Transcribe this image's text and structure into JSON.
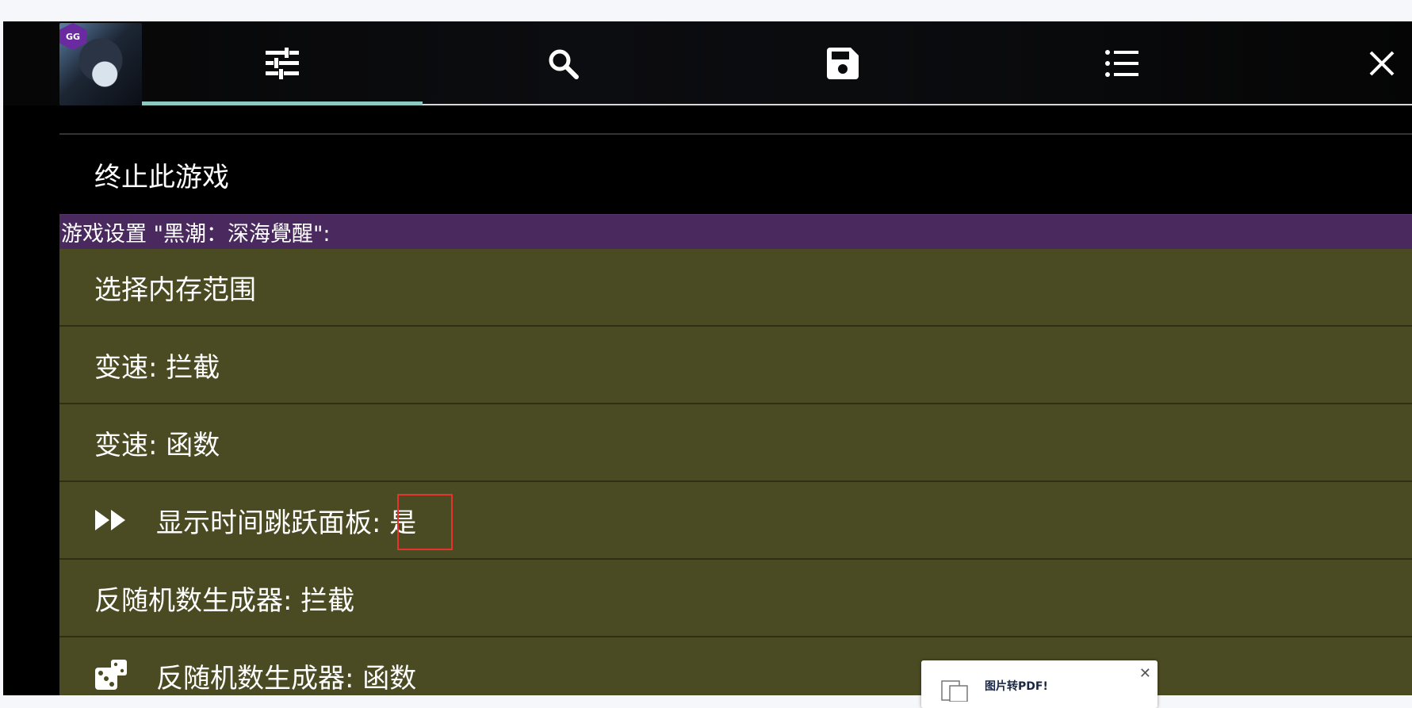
{
  "toolbar": {
    "tabs": [
      {
        "icon": "sliders-icon"
      },
      {
        "icon": "search-icon"
      },
      {
        "icon": "save-icon"
      },
      {
        "icon": "list-icon"
      }
    ],
    "close_icon": "close-icon",
    "badge": "GG",
    "accent_color": "#8ec8c0"
  },
  "menu": {
    "partial_label": "",
    "terminate_label": "终止此游戏",
    "section_header": "游戏设置 \"黑潮：深海覺醒\":",
    "items": [
      {
        "label": "选择内存范围"
      },
      {
        "label": "变速: 拦截"
      },
      {
        "label": "变速: 函数"
      },
      {
        "label": "显示时间跳跃面板",
        "value": ": 是",
        "icon": "fast-forward-icon"
      },
      {
        "label": "反随机数生成器: 拦截"
      },
      {
        "label": "反随机数生成器: 函数",
        "icon": "dice-icon"
      }
    ]
  },
  "popup": {
    "title": "图片转PDF!"
  },
  "colors": {
    "section_header_bg": "#4a2a5e",
    "option_row_bg": "#4a4a23",
    "highlight": "#e8322c"
  }
}
